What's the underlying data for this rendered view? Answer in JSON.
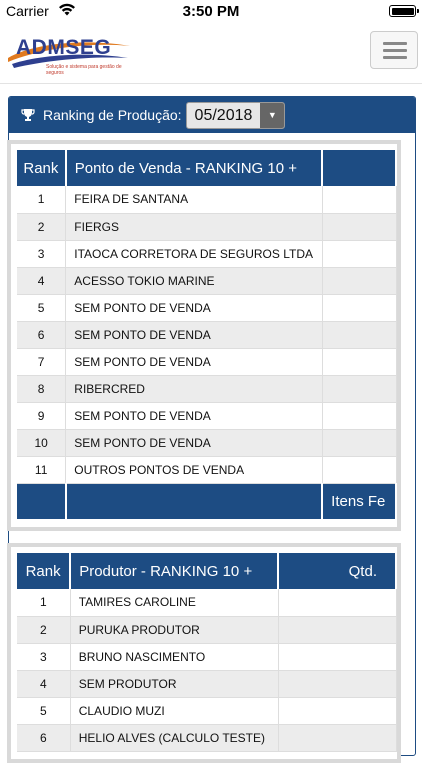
{
  "status": {
    "carrier": "Carrier",
    "time": "3:50 PM"
  },
  "header": {
    "logo_text": "ADMSEG",
    "logo_tagline": "Solução e sistema para gestão de seguros"
  },
  "panel": {
    "title": "Ranking de Produção:",
    "period": "05/2018"
  },
  "table1": {
    "headers": [
      "Rank",
      "Ponto de Venda - RANKING 10 +",
      ""
    ],
    "rows": [
      [
        "1",
        "FEIRA DE SANTANA"
      ],
      [
        "2",
        "FIERGS"
      ],
      [
        "3",
        "ITAOCA CORRETORA DE SEGUROS LTDA"
      ],
      [
        "4",
        "ACESSO TOKIO MARINE"
      ],
      [
        "5",
        "SEM PONTO DE VENDA"
      ],
      [
        "6",
        "SEM PONTO DE VENDA"
      ],
      [
        "7",
        "SEM PONTO DE VENDA"
      ],
      [
        "8",
        "RIBERCRED"
      ],
      [
        "9",
        "SEM PONTO DE VENDA"
      ],
      [
        "10",
        "SEM PONTO DE VENDA"
      ],
      [
        "11",
        "OUTROS PONTOS DE VENDA"
      ]
    ],
    "footer": [
      "",
      "",
      "Itens Fe"
    ]
  },
  "table2": {
    "headers": [
      "Rank",
      "Produtor - RANKING 10 +",
      "Qtd."
    ],
    "rows": [
      [
        "1",
        "TAMIRES CAROLINE"
      ],
      [
        "2",
        "PURUKA PRODUTOR"
      ],
      [
        "3",
        "BRUNO NASCIMENTO"
      ],
      [
        "4",
        "SEM PRODUTOR"
      ],
      [
        "5",
        "CLAUDIO MUZI"
      ],
      [
        "6",
        "HELIO ALVES (CALCULO TESTE)"
      ]
    ]
  },
  "colors": {
    "header_blue": "#1d4c83",
    "stripe": "#ececec"
  }
}
